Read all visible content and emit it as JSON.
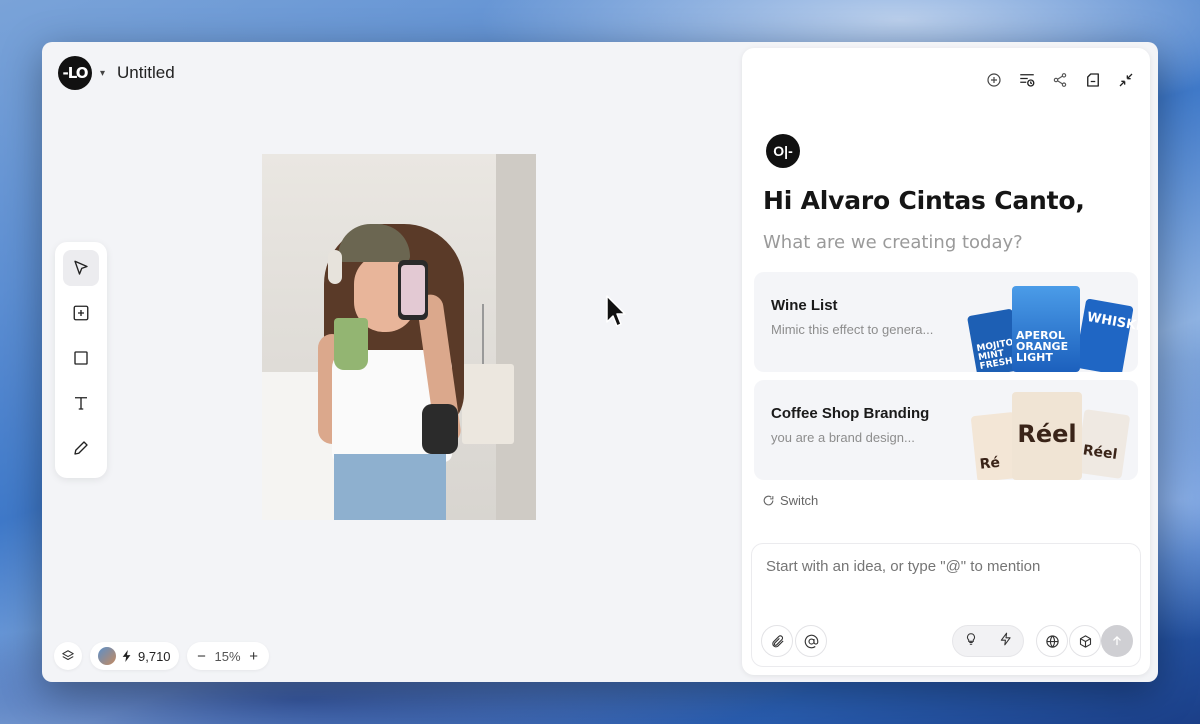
{
  "document": {
    "title": "Untitled",
    "logo_text": "-LO"
  },
  "tools": [
    {
      "name": "select-tool",
      "icon": "pointer-arrow-icon"
    },
    {
      "name": "add-frame-tool",
      "icon": "plus-square-icon"
    },
    {
      "name": "rectangle-tool",
      "icon": "square-icon"
    },
    {
      "name": "text-tool",
      "icon": "text-t-icon"
    },
    {
      "name": "pen-tool",
      "icon": "pencil-icon"
    }
  ],
  "bottom_bar": {
    "credits": "9,710",
    "zoom": "15%",
    "zoom_out_label": "−",
    "zoom_in_label": "+"
  },
  "panel": {
    "greeting": "Hi Alvaro Cintas Canto,",
    "subtitle": "What are we creating today?",
    "logo_text": "O|-",
    "header_icons": [
      "new-chat-icon",
      "history-icon",
      "share-icon",
      "assets-icon",
      "collapse-icon"
    ],
    "cards": [
      {
        "title": "Wine List",
        "description": "Mimic this effect to genera...",
        "tiles": [
          "MOJITO MINT FRESH",
          "APEROL ORANGE LIGHT",
          "WHISKEY"
        ]
      },
      {
        "title": "Coffee Shop Branding",
        "description": "you are a brand design...",
        "tiles": [
          "Ré",
          "Réel",
          "Réel"
        ]
      }
    ],
    "switch_label": "Switch",
    "composer": {
      "placeholder": "Start with an idea, or type \"@\" to mention"
    }
  },
  "colors": {
    "accent_dark": "#111111",
    "panel_bg": "#ffffff",
    "canvas_bg": "#f3f4f7",
    "wine_blue": "#1f6ec6"
  }
}
